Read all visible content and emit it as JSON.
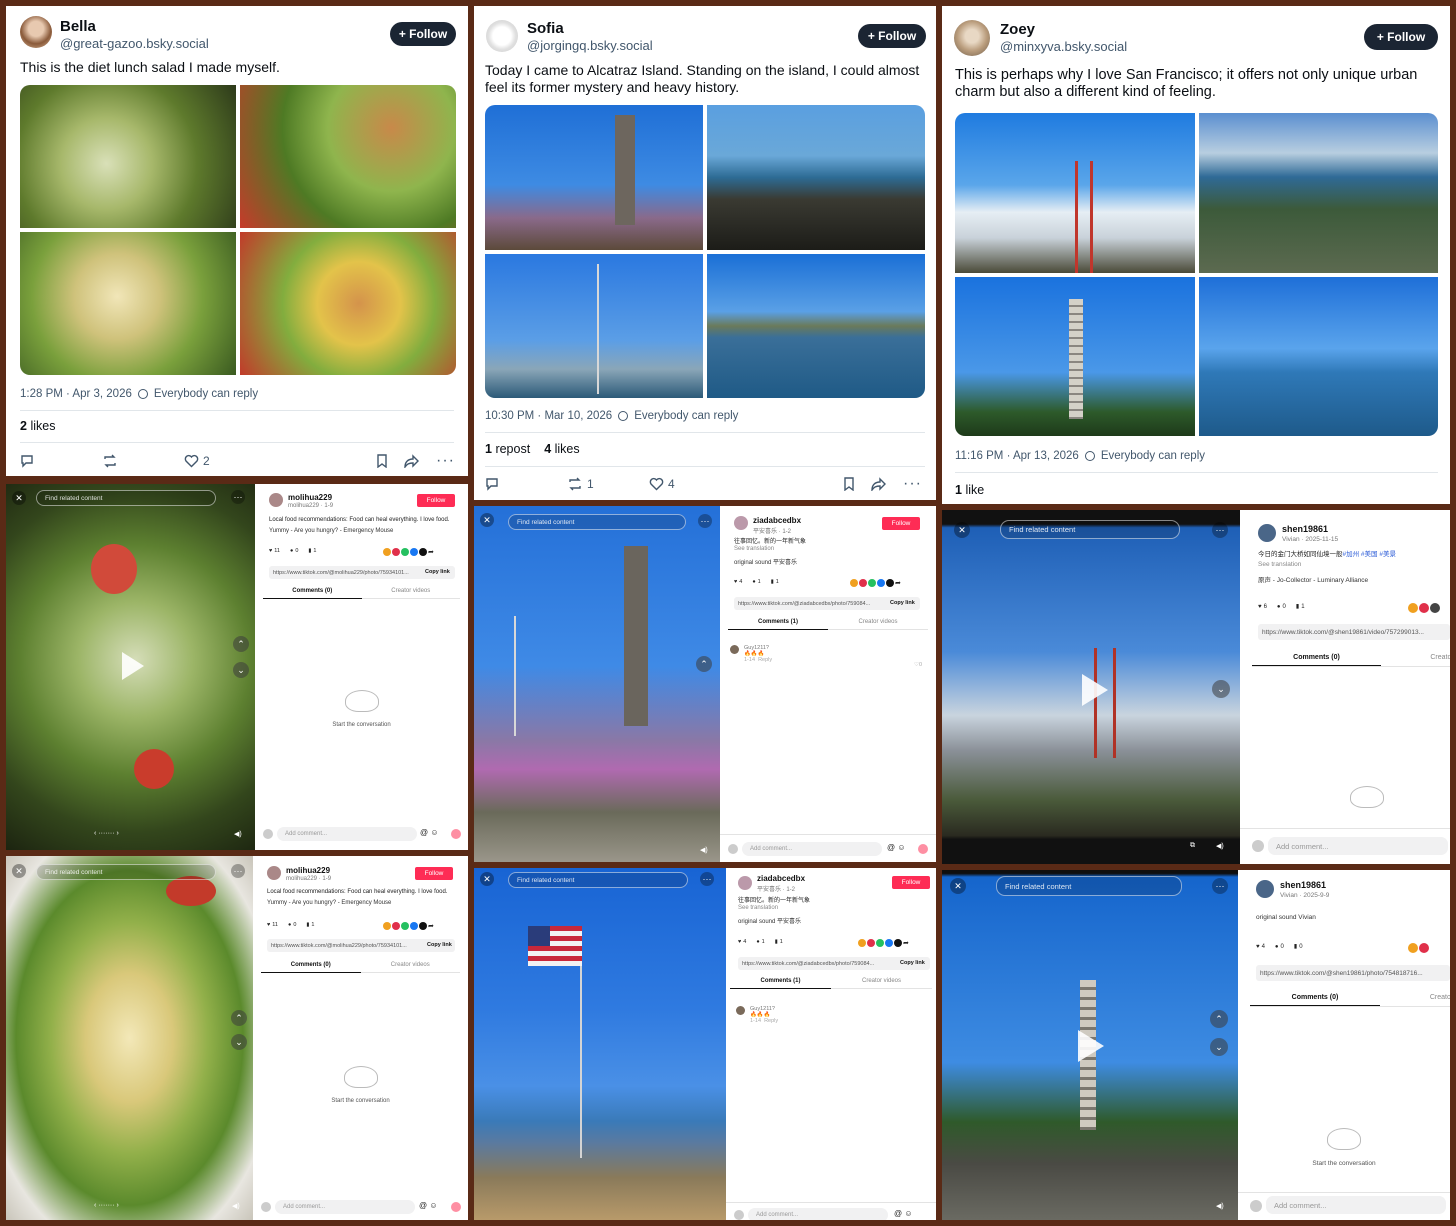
{
  "posts": [
    {
      "name": "Bella",
      "handle": "@great-gazoo.bsky.social",
      "follow": "+ Follow",
      "text": "This is the diet lunch salad I made myself.",
      "time": "1:28 PM · Apr 3, 2026",
      "reply": "Everybody can reply",
      "likes_num": "2",
      "likes_word": "likes",
      "repost_count": "",
      "like_count": "2"
    },
    {
      "name": "Sofia",
      "handle": "@jorgingq.bsky.social",
      "follow": "+ Follow",
      "text": "Today I came to Alcatraz Island. Standing on the island, I could almost feel its former mystery and heavy history.",
      "time": "10:30 PM · Mar 10, 2026",
      "reply": "Everybody can reply",
      "repost_num": "1",
      "repost_word": "repost",
      "likes_num": "4",
      "likes_word": "likes",
      "repost_count": "1",
      "like_count": "4"
    },
    {
      "name": "Zoey",
      "handle": "@minxyva.bsky.social",
      "follow": "+ Follow",
      "text": "This is perhaps why I love San Francisco; it offers not only unique urban charm but also a different kind of feeling.",
      "time": "11:16 PM · Apr 13, 2026",
      "reply": "Everybody can reply",
      "likes_num": "1",
      "likes_word": "like"
    }
  ],
  "tiktok": {
    "search_placeholder": "Find related content",
    "comment_placeholder": "Add comment...",
    "copy_link": "Copy link",
    "tab_comments_0": "Comments (0)",
    "tab_comments_1": "Comments (1)",
    "tab_creator": "Creator videos",
    "empty": "Start the conversation",
    "see_translation": "See translation",
    "follow": "Follow",
    "panels": [
      {
        "user": "molihua229",
        "sub": "molihua229 · 1-9",
        "desc": "Local food recommendations: Food can heal everything. I love food.",
        "sound": "Yummy - Are you hungry? - Emergency Mouse",
        "likes": "11",
        "comments": "0",
        "saves": "1",
        "link": "https://www.tiktok.com/@molihua229/photo/75934101..."
      },
      {
        "user": "ziadabcedbx",
        "sub": "平安喜乐 · 1-2",
        "desc": "往事回忆。新的一年新气象",
        "sound": "original sound 平安喜乐",
        "likes": "4",
        "comments": "1",
        "saves": "1",
        "link": "https://www.tiktok.com/@ziadabcedbx/photo/759084...",
        "comment_user": "Guy1211?",
        "comment_text": "🔥🔥🔥",
        "comment_date": "1-14",
        "comment_reply": "Reply",
        "comment_likes": "0"
      },
      {
        "user": "shen19861",
        "sub": "Vivian · 2025-11-15",
        "desc_plain": "今日的金门大桥如同仙境一般",
        "desc_tags": "#加州 #美国 #美景",
        "sound": "原声 - Jo-Collector - Luminary Alliance",
        "likes": "6",
        "comments": "0",
        "saves": "1",
        "link": "https://www.tiktok.com/@shen19861/video/757299013...",
        "creator_short": "Creator vi"
      },
      {
        "user": "molihua229",
        "sub": "molihua229 · 1-9",
        "desc": "Local food recommendations: Food can heal everything. I love food.",
        "sound": "Yummy - Are you hungry? - Emergency Mouse",
        "likes": "11",
        "comments": "0",
        "saves": "1",
        "link": "https://www.tiktok.com/@molihua229/photo/75934101..."
      },
      {
        "user": "ziadabcedbx",
        "sub": "平安喜乐 · 1-2",
        "desc": "往事回忆。新的一年新气象",
        "sound": "original sound 平安喜乐",
        "likes": "4",
        "comments": "1",
        "saves": "1",
        "link": "https://www.tiktok.com/@ziadabcedbx/photo/759084...",
        "comment_user": "Guy1211?",
        "comment_text": "🔥🔥🔥",
        "comment_date": "1-14",
        "comment_reply": "Reply"
      },
      {
        "user": "shen19861",
        "sub": "Vivian · 2025-9-9",
        "sound": "original sound Vivian",
        "likes": "4",
        "comments": "0",
        "saves": "0",
        "link": "https://www.tiktok.com/@shen19861/photo/754818716...",
        "creator_short": "Creator vi"
      }
    ]
  },
  "colors": {
    "bluesky_dark_button": "#1b2533",
    "tiktok_red": "#fe2c55",
    "background": "#5a2a16"
  }
}
